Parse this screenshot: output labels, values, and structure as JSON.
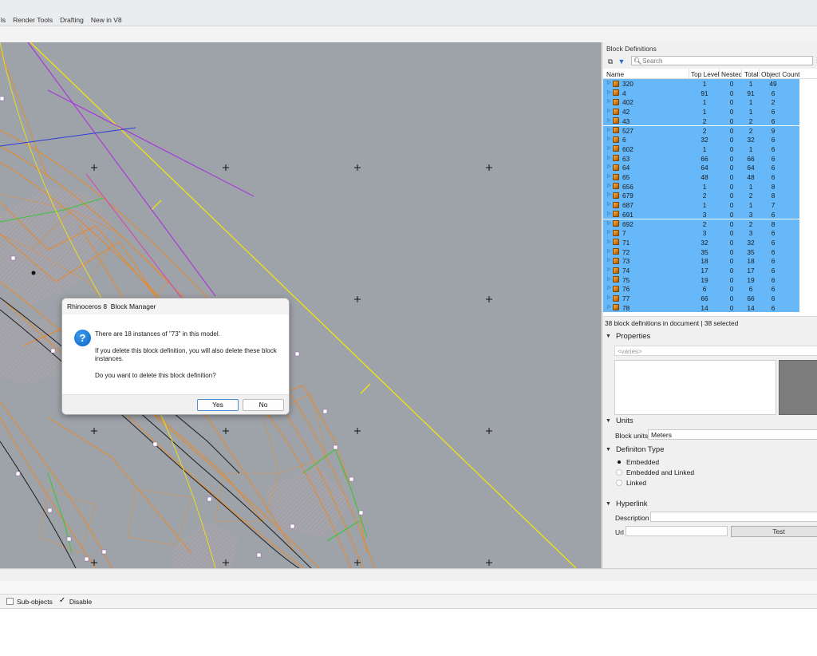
{
  "tabs": [
    "ls",
    "Render Tools",
    "Drafting",
    "New in V8"
  ],
  "osnap": {
    "items": [
      {
        "label": "Sub-objects",
        "checked": false
      },
      {
        "label": "Disable",
        "checked": true
      }
    ]
  },
  "panel": {
    "title": "Block Definitions",
    "search_placeholder": "Search",
    "columns": {
      "name": "Name",
      "top_level": "Top Level",
      "nested": "Nested",
      "total": "Total",
      "object_count": "Object Count"
    },
    "rows": [
      {
        "name": "320",
        "top": "1",
        "nested": "0",
        "total": "1",
        "count": "49"
      },
      {
        "name": "4",
        "top": "91",
        "nested": "0",
        "total": "91",
        "count": "6"
      },
      {
        "name": "402",
        "top": "1",
        "nested": "0",
        "total": "1",
        "count": "2"
      },
      {
        "name": "42",
        "top": "1",
        "nested": "0",
        "total": "1",
        "count": "6"
      },
      {
        "name": "43",
        "top": "2",
        "nested": "0",
        "total": "2",
        "count": "6"
      },
      {
        "name": "527",
        "top": "2",
        "nested": "0",
        "total": "2",
        "count": "9"
      },
      {
        "name": "6",
        "top": "32",
        "nested": "0",
        "total": "32",
        "count": "6"
      },
      {
        "name": "602",
        "top": "1",
        "nested": "0",
        "total": "1",
        "count": "6"
      },
      {
        "name": "63",
        "top": "66",
        "nested": "0",
        "total": "66",
        "count": "6"
      },
      {
        "name": "64",
        "top": "64",
        "nested": "0",
        "total": "64",
        "count": "6"
      },
      {
        "name": "65",
        "top": "48",
        "nested": "0",
        "total": "48",
        "count": "6"
      },
      {
        "name": "656",
        "top": "1",
        "nested": "0",
        "total": "1",
        "count": "8"
      },
      {
        "name": "679",
        "top": "2",
        "nested": "0",
        "total": "2",
        "count": "8"
      },
      {
        "name": "687",
        "top": "1",
        "nested": "0",
        "total": "1",
        "count": "7"
      },
      {
        "name": "691",
        "top": "3",
        "nested": "0",
        "total": "3",
        "count": "6"
      },
      {
        "name": "692",
        "top": "2",
        "nested": "0",
        "total": "2",
        "count": "8"
      },
      {
        "name": "7",
        "top": "3",
        "nested": "0",
        "total": "3",
        "count": "6"
      },
      {
        "name": "71",
        "top": "32",
        "nested": "0",
        "total": "32",
        "count": "6"
      },
      {
        "name": "72",
        "top": "35",
        "nested": "0",
        "total": "35",
        "count": "6"
      },
      {
        "name": "73",
        "top": "18",
        "nested": "0",
        "total": "18",
        "count": "6"
      },
      {
        "name": "74",
        "top": "17",
        "nested": "0",
        "total": "17",
        "count": "6"
      },
      {
        "name": "75",
        "top": "19",
        "nested": "0",
        "total": "19",
        "count": "6"
      },
      {
        "name": "76",
        "top": "6",
        "nested": "0",
        "total": "6",
        "count": "6"
      },
      {
        "name": "77",
        "top": "66",
        "nested": "0",
        "total": "66",
        "count": "6"
      },
      {
        "name": "78",
        "top": "14",
        "nested": "0",
        "total": "14",
        "count": "6"
      }
    ],
    "footer": "38 block definitions in document | 38 selected",
    "properties": {
      "header": "Properties",
      "varies": "<varies>"
    },
    "units": {
      "header": "Units",
      "label": "Block units",
      "value": "Meters"
    },
    "definition_type": {
      "header": "Definiton Type",
      "options": [
        {
          "label": "Embedded",
          "selected": true
        },
        {
          "label": "Embedded and Linked",
          "selected": false
        },
        {
          "label": "Linked",
          "selected": false
        }
      ]
    },
    "hyperlink": {
      "header": "Hyperlink",
      "description_label": "Description",
      "url_label": "Url",
      "test_button": "Test",
      "description_value": "",
      "url_value": ""
    }
  },
  "dialog": {
    "title": "Rhinoceros 8  Block Manager",
    "icon": "question-icon",
    "line1": "There are 18 instances of \"73\" in this model.",
    "line2": "If you delete this block definition, you will also delete these block instances.",
    "line3": "Do you want to delete this block definition?",
    "yes": "Yes",
    "no": "No"
  },
  "colors": {
    "viewport_bg": "#9ea3a9",
    "selection": "#66b8f9",
    "curve_orange": "#e8892a",
    "curve_yellow": "#f2e30f",
    "curve_purple": "#a63ad9",
    "curve_blue": "#2b3ed6",
    "curve_green": "#3cc43c",
    "hatch_pink": "#e7a3a3"
  }
}
